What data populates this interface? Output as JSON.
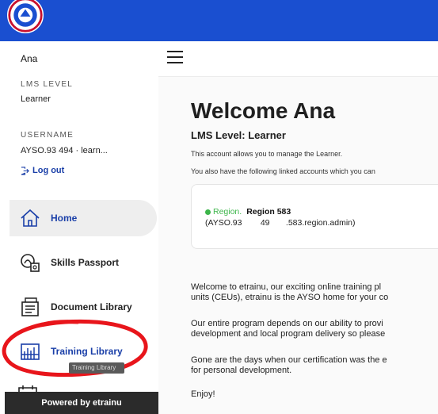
{
  "app": {
    "logo_icon": "ayso-logo-icon",
    "brand_color": "#1a4fd0"
  },
  "sidebar": {
    "user_name": "Ana",
    "lms_level_label": "LMS LEVEL",
    "lms_level_value": "Learner",
    "username_label": "USERNAME",
    "username_value": "AYSO.93     494  ·  learn...",
    "logout_label": "Log out",
    "items": [
      {
        "label": "Home",
        "icon": "home-icon",
        "active": true
      },
      {
        "label": "Skills Passport",
        "icon": "skills-passport-icon",
        "active": false
      },
      {
        "label": "Document Library",
        "icon": "document-library-icon",
        "active": false
      },
      {
        "label": "Training Library",
        "icon": "training-library-icon",
        "active": false
      }
    ],
    "tooltip": "Training Library",
    "powered_by": "Powered by etrainu"
  },
  "main": {
    "title": "Welcome Ana",
    "lms_level": "LMS Level: Learner",
    "account_note": "This account allows you to manage the Learner.",
    "linked_note": "You also have the following linked accounts which you can",
    "linked_account": {
      "type_label": "Region.",
      "name": "Region 583",
      "detail": "(AYSO.93        49       .583.region.admin)",
      "status_color": "#3cb54a"
    },
    "paragraphs": [
      [
        "Welcome to etrainu, our exciting online training pl",
        "units (CEUs), etrainu is the AYSO home for your co"
      ],
      [
        "Our entire program depends on our ability to provi",
        "development and local program delivery so please"
      ],
      [
        "Gone are the days when our certification was the e",
        "for personal development."
      ],
      [
        "Enjoy!"
      ]
    ]
  }
}
